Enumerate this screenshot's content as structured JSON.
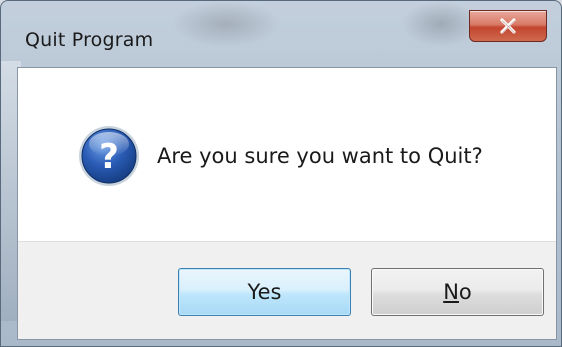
{
  "window": {
    "title": "Quit Program"
  },
  "titlebar": {
    "close_icon": "close-x-icon"
  },
  "dialog": {
    "icon": "question-icon",
    "message": "Are you sure you want to Quit?"
  },
  "buttons": {
    "yes_label": "Yes",
    "no_mnemonic": "N",
    "no_rest": "o"
  },
  "colors": {
    "close_button": "#c3452f",
    "default_button_border": "#3c7fb1",
    "icon_blue": "#1f4fa0"
  }
}
